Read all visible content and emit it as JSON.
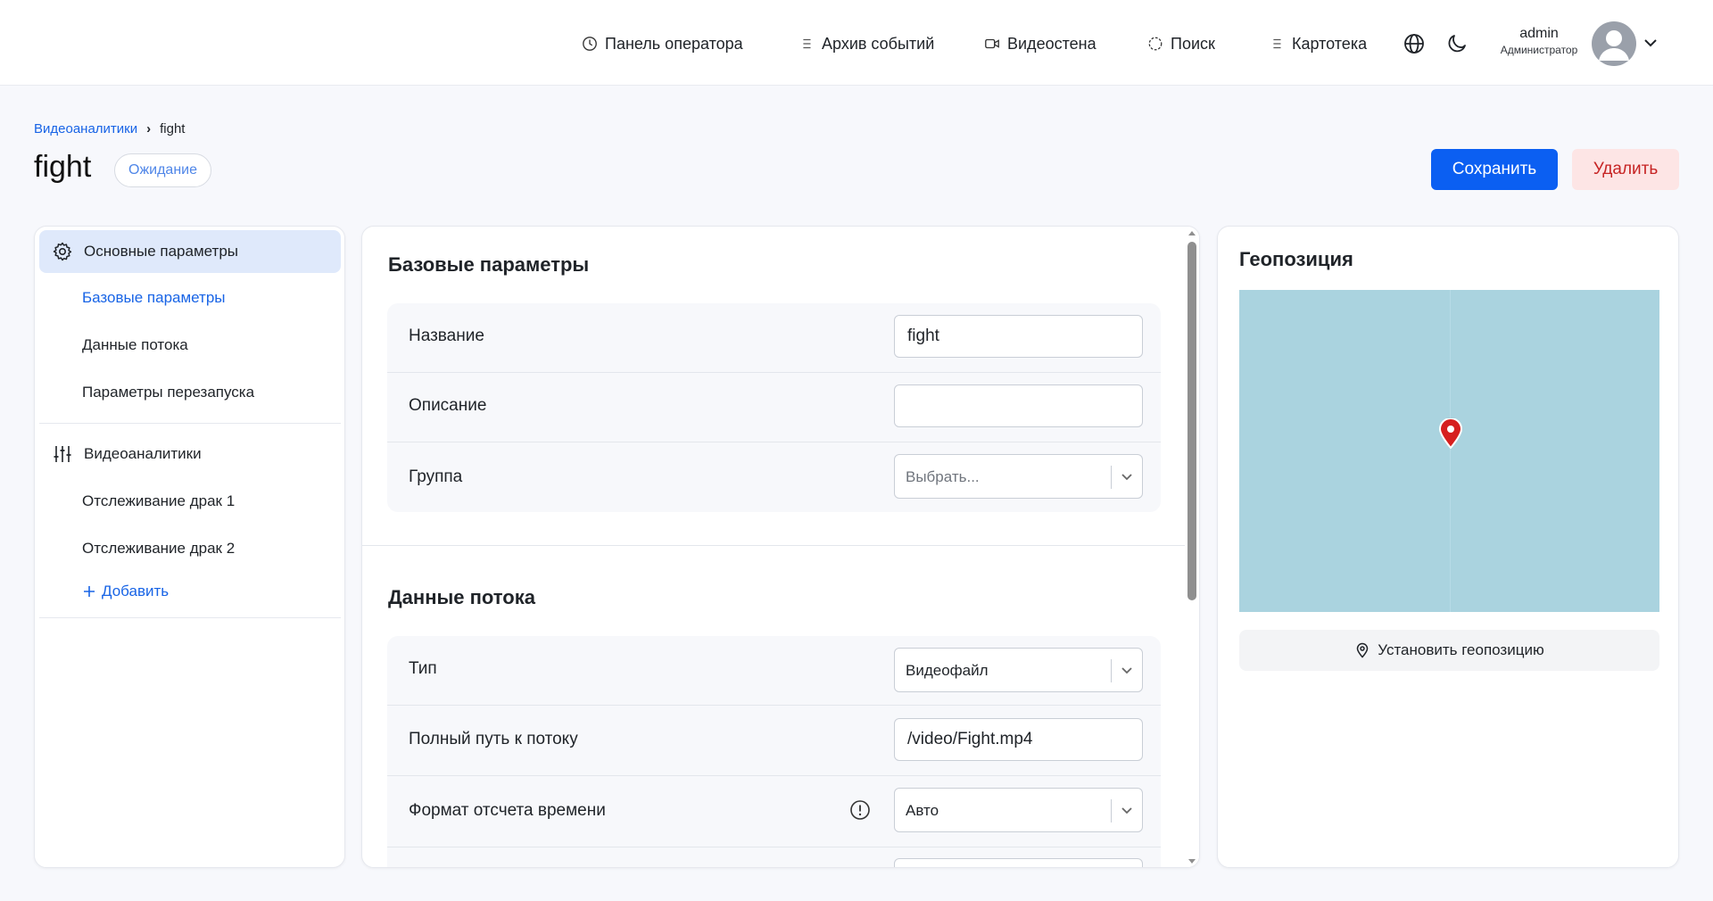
{
  "header": {
    "nav": [
      {
        "label": "Панель оператора",
        "icon": "clock-icon"
      },
      {
        "label": "Архив событий",
        "icon": "list-icon"
      },
      {
        "label": "Видеостена",
        "icon": "video-camera-icon"
      },
      {
        "label": "Поиск",
        "icon": "crosshair-icon"
      },
      {
        "label": "Картотека",
        "icon": "list-icon"
      }
    ],
    "language_icon": "globe-icon",
    "theme_icon": "moon-icon",
    "user": {
      "name": "admin",
      "role": "Администратор"
    }
  },
  "breadcrumb": {
    "parent": "Видеоаналитики",
    "separator": "›",
    "current": "fight"
  },
  "page": {
    "title": "fight",
    "status": "Ожидание"
  },
  "actions": {
    "save": "Сохранить",
    "delete": "Удалить"
  },
  "sidebar": {
    "sections": [
      {
        "label": "Основные параметры",
        "icon": "gear-icon",
        "items": [
          "Базовые параметры",
          "Данные потока",
          "Параметры перезапуска"
        ]
      },
      {
        "label": "Видеоаналитики",
        "icon": "sliders-icon",
        "items": [
          "Отслеживание драк 1",
          "Отслеживание драк 2"
        ],
        "add_label": "Добавить"
      }
    ]
  },
  "form": {
    "base": {
      "title": "Базовые параметры",
      "name_label": "Название",
      "name_value": "fight",
      "description_label": "Описание",
      "description_value": "",
      "group_label": "Группа",
      "group_placeholder": "Выбрать..."
    },
    "stream": {
      "title": "Данные потока",
      "type_label": "Тип",
      "type_value": "Видеофайл",
      "path_label": "Полный путь к потоку",
      "path_value": "/video/Fight.mp4",
      "time_format_label": "Формат отсчета времени",
      "time_format_value": "Авто"
    }
  },
  "geo": {
    "title": "Геопозиция",
    "button": "Установить геопозицию"
  },
  "colors": {
    "accent": "#0b5ff2",
    "link": "#1864e6",
    "delete_bg": "#fde5e5",
    "delete_text": "#c62424",
    "map_water": "#aad3df",
    "pin": "#d61f1f"
  }
}
